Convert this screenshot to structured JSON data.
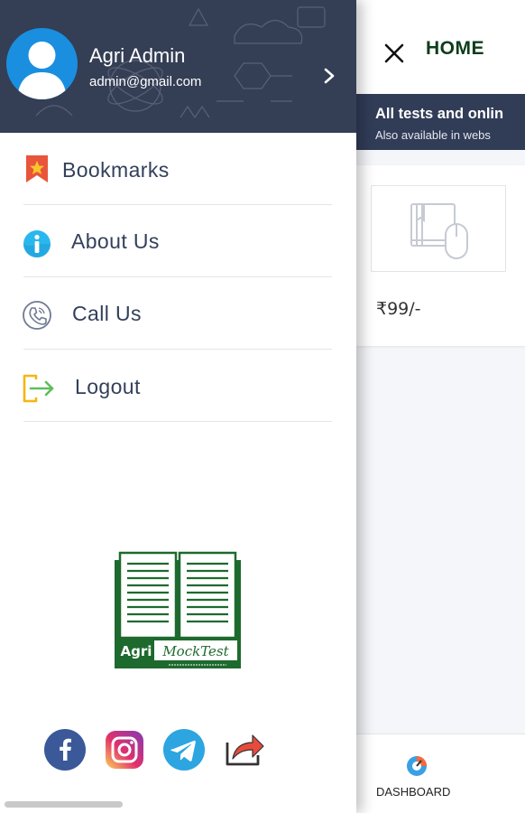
{
  "user": {
    "name": "Agri Admin",
    "email": "admin@gmail.com"
  },
  "menu": {
    "items": [
      {
        "label": "Bookmarks",
        "icon": "bookmark-icon"
      },
      {
        "label": "About Us",
        "icon": "info-icon"
      },
      {
        "label": "Call Us",
        "icon": "phone-icon"
      },
      {
        "label": "Logout",
        "icon": "logout-icon"
      }
    ]
  },
  "logo": {
    "left_text": "Agri",
    "right_text": "MockTest"
  },
  "socials": [
    "facebook-icon",
    "instagram-icon",
    "telegram-icon",
    "share-icon"
  ],
  "app": {
    "title": "HOME",
    "banner_title": "All tests and onlin",
    "banner_subtitle": "Also available in webs",
    "price": "₹99/-",
    "nav_dashboard": "DASHBOARD"
  },
  "colors": {
    "header_bg": "#343e55",
    "banner_bg": "#313c57",
    "menu_text": "#33405b",
    "logo_green": "#1e6a2e",
    "home_title": "#0d3d1a"
  }
}
